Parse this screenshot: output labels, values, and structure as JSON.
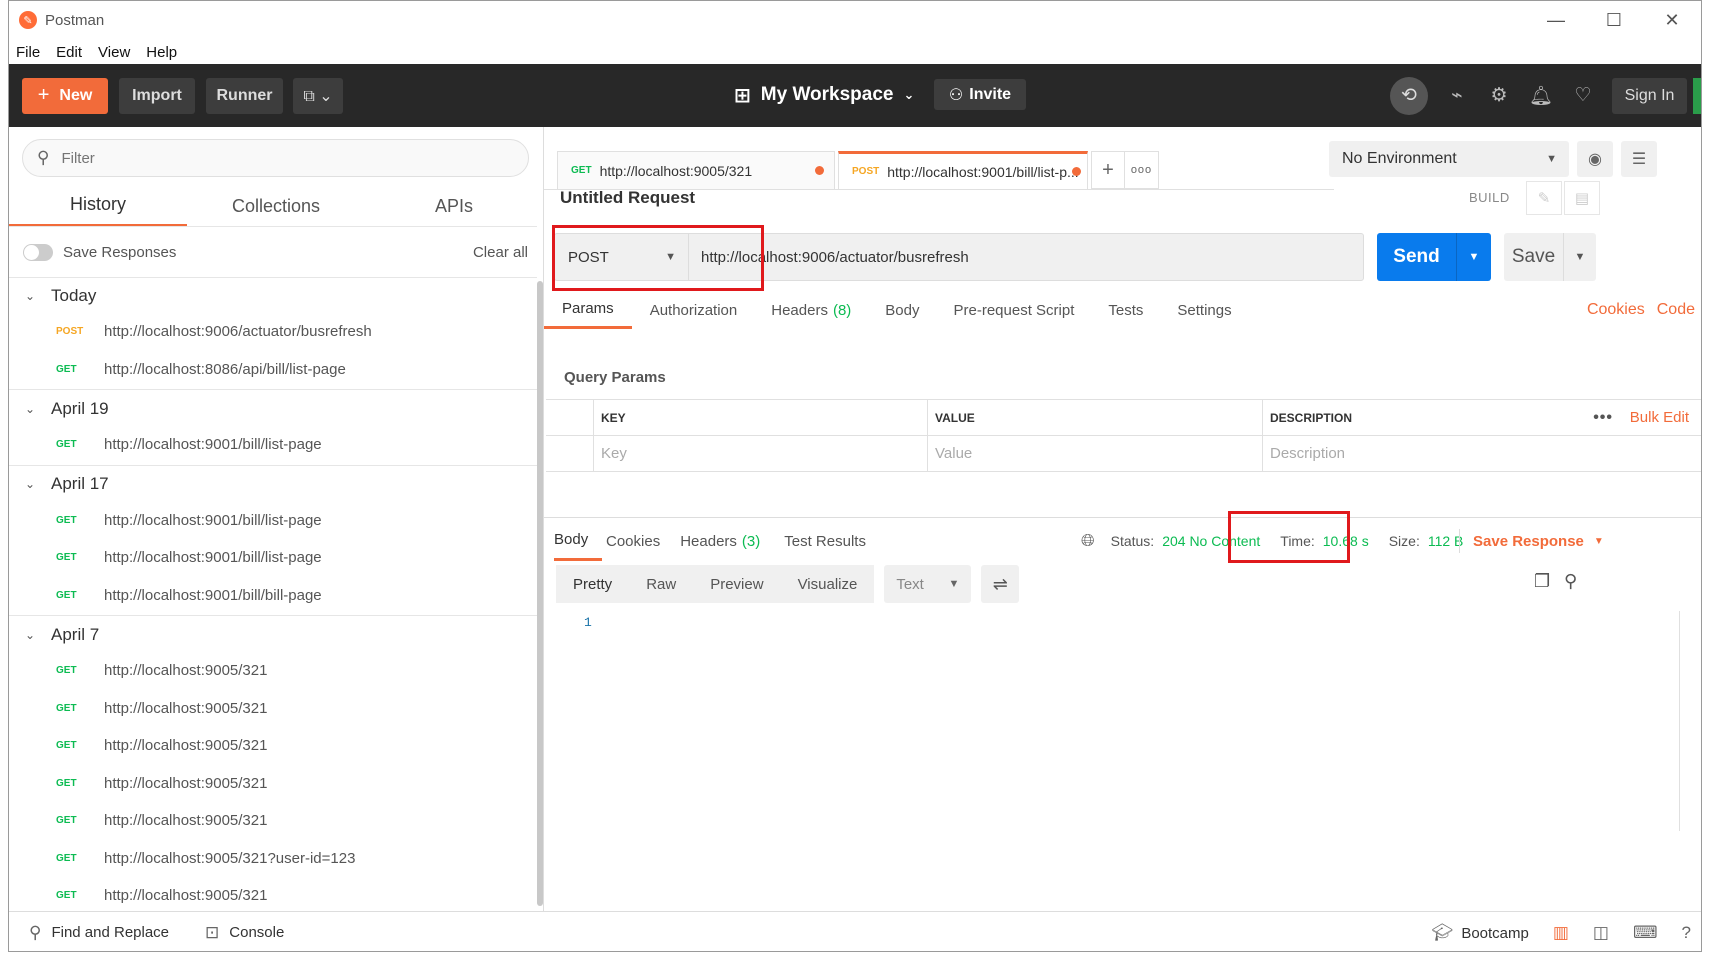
{
  "window": {
    "title": "Postman",
    "menu": [
      "File",
      "Edit",
      "View",
      "Help"
    ]
  },
  "header": {
    "new_label": "New",
    "import_label": "Import",
    "runner_label": "Runner",
    "workspace_label": "My Workspace",
    "invite_label": "Invite",
    "signin_label": "Sign In"
  },
  "sidebar": {
    "filter_placeholder": "Filter",
    "tabs": [
      "History",
      "Collections",
      "APIs"
    ],
    "save_responses_label": "Save Responses",
    "clear_all_label": "Clear all",
    "groups": [
      {
        "label": "Today",
        "items": [
          {
            "method": "POST",
            "url": "http://localhost:9006/actuator/busrefresh"
          },
          {
            "method": "GET",
            "url": "http://localhost:8086/api/bill/list-page"
          }
        ]
      },
      {
        "label": "April 19",
        "items": [
          {
            "method": "GET",
            "url": "http://localhost:9001/bill/list-page"
          }
        ]
      },
      {
        "label": "April 17",
        "items": [
          {
            "method": "GET",
            "url": "http://localhost:9001/bill/list-page"
          },
          {
            "method": "GET",
            "url": "http://localhost:9001/bill/list-page"
          },
          {
            "method": "GET",
            "url": "http://localhost:9001/bill/bill-page"
          }
        ]
      },
      {
        "label": "April 7",
        "items": [
          {
            "method": "GET",
            "url": "http://localhost:9005/321"
          },
          {
            "method": "GET",
            "url": "http://localhost:9005/321"
          },
          {
            "method": "GET",
            "url": "http://localhost:9005/321"
          },
          {
            "method": "GET",
            "url": "http://localhost:9005/321"
          },
          {
            "method": "GET",
            "url": "http://localhost:9005/321"
          },
          {
            "method": "GET",
            "url": "http://localhost:9005/321?user-id=123"
          },
          {
            "method": "GET",
            "url": "http://localhost:9005/321"
          }
        ]
      }
    ]
  },
  "request_tabs": [
    {
      "method": "GET",
      "label": "http://localhost:9005/321"
    },
    {
      "method": "POST",
      "label": "http://localhost:9001/bill/list-p..."
    }
  ],
  "environment": {
    "selected": "No Environment"
  },
  "request": {
    "name": "Untitled Request",
    "build_label": "BUILD",
    "method": "POST",
    "url": "http://localhost:9006/actuator/busrefresh",
    "send_label": "Send",
    "save_label": "Save"
  },
  "param_tabs": {
    "params": "Params",
    "authorization": "Authorization",
    "headers": "Headers",
    "headers_count": "(8)",
    "body": "Body",
    "prerequest": "Pre-request Script",
    "tests": "Tests",
    "settings": "Settings",
    "cookies": "Cookies",
    "code": "Code"
  },
  "query_params": {
    "title": "Query Params",
    "columns": [
      "KEY",
      "VALUE",
      "DESCRIPTION"
    ],
    "bulk_edit": "Bulk Edit",
    "placeholders": [
      "Key",
      "Value",
      "Description"
    ]
  },
  "response": {
    "tabs": {
      "body": "Body",
      "cookies": "Cookies",
      "headers": "Headers",
      "headers_count": "(3)",
      "tests": "Test Results"
    },
    "status_label": "Status:",
    "status_value": "204 No Content",
    "time_label": "Time:",
    "time_value": "10.68 s",
    "size_label": "Size:",
    "size_value": "112 B",
    "save_response_label": "Save Response",
    "formats": [
      "Pretty",
      "Raw",
      "Preview",
      "Visualize"
    ],
    "text_type": "Text",
    "line_number": "1"
  },
  "footer": {
    "find_replace": "Find and Replace",
    "console": "Console",
    "bootcamp": "Bootcamp"
  },
  "colors": {
    "accent": "#f26b3a",
    "send": "#097bed",
    "get": "#0cbb52",
    "post": "#f5a623",
    "highlight": "#e0191c"
  }
}
